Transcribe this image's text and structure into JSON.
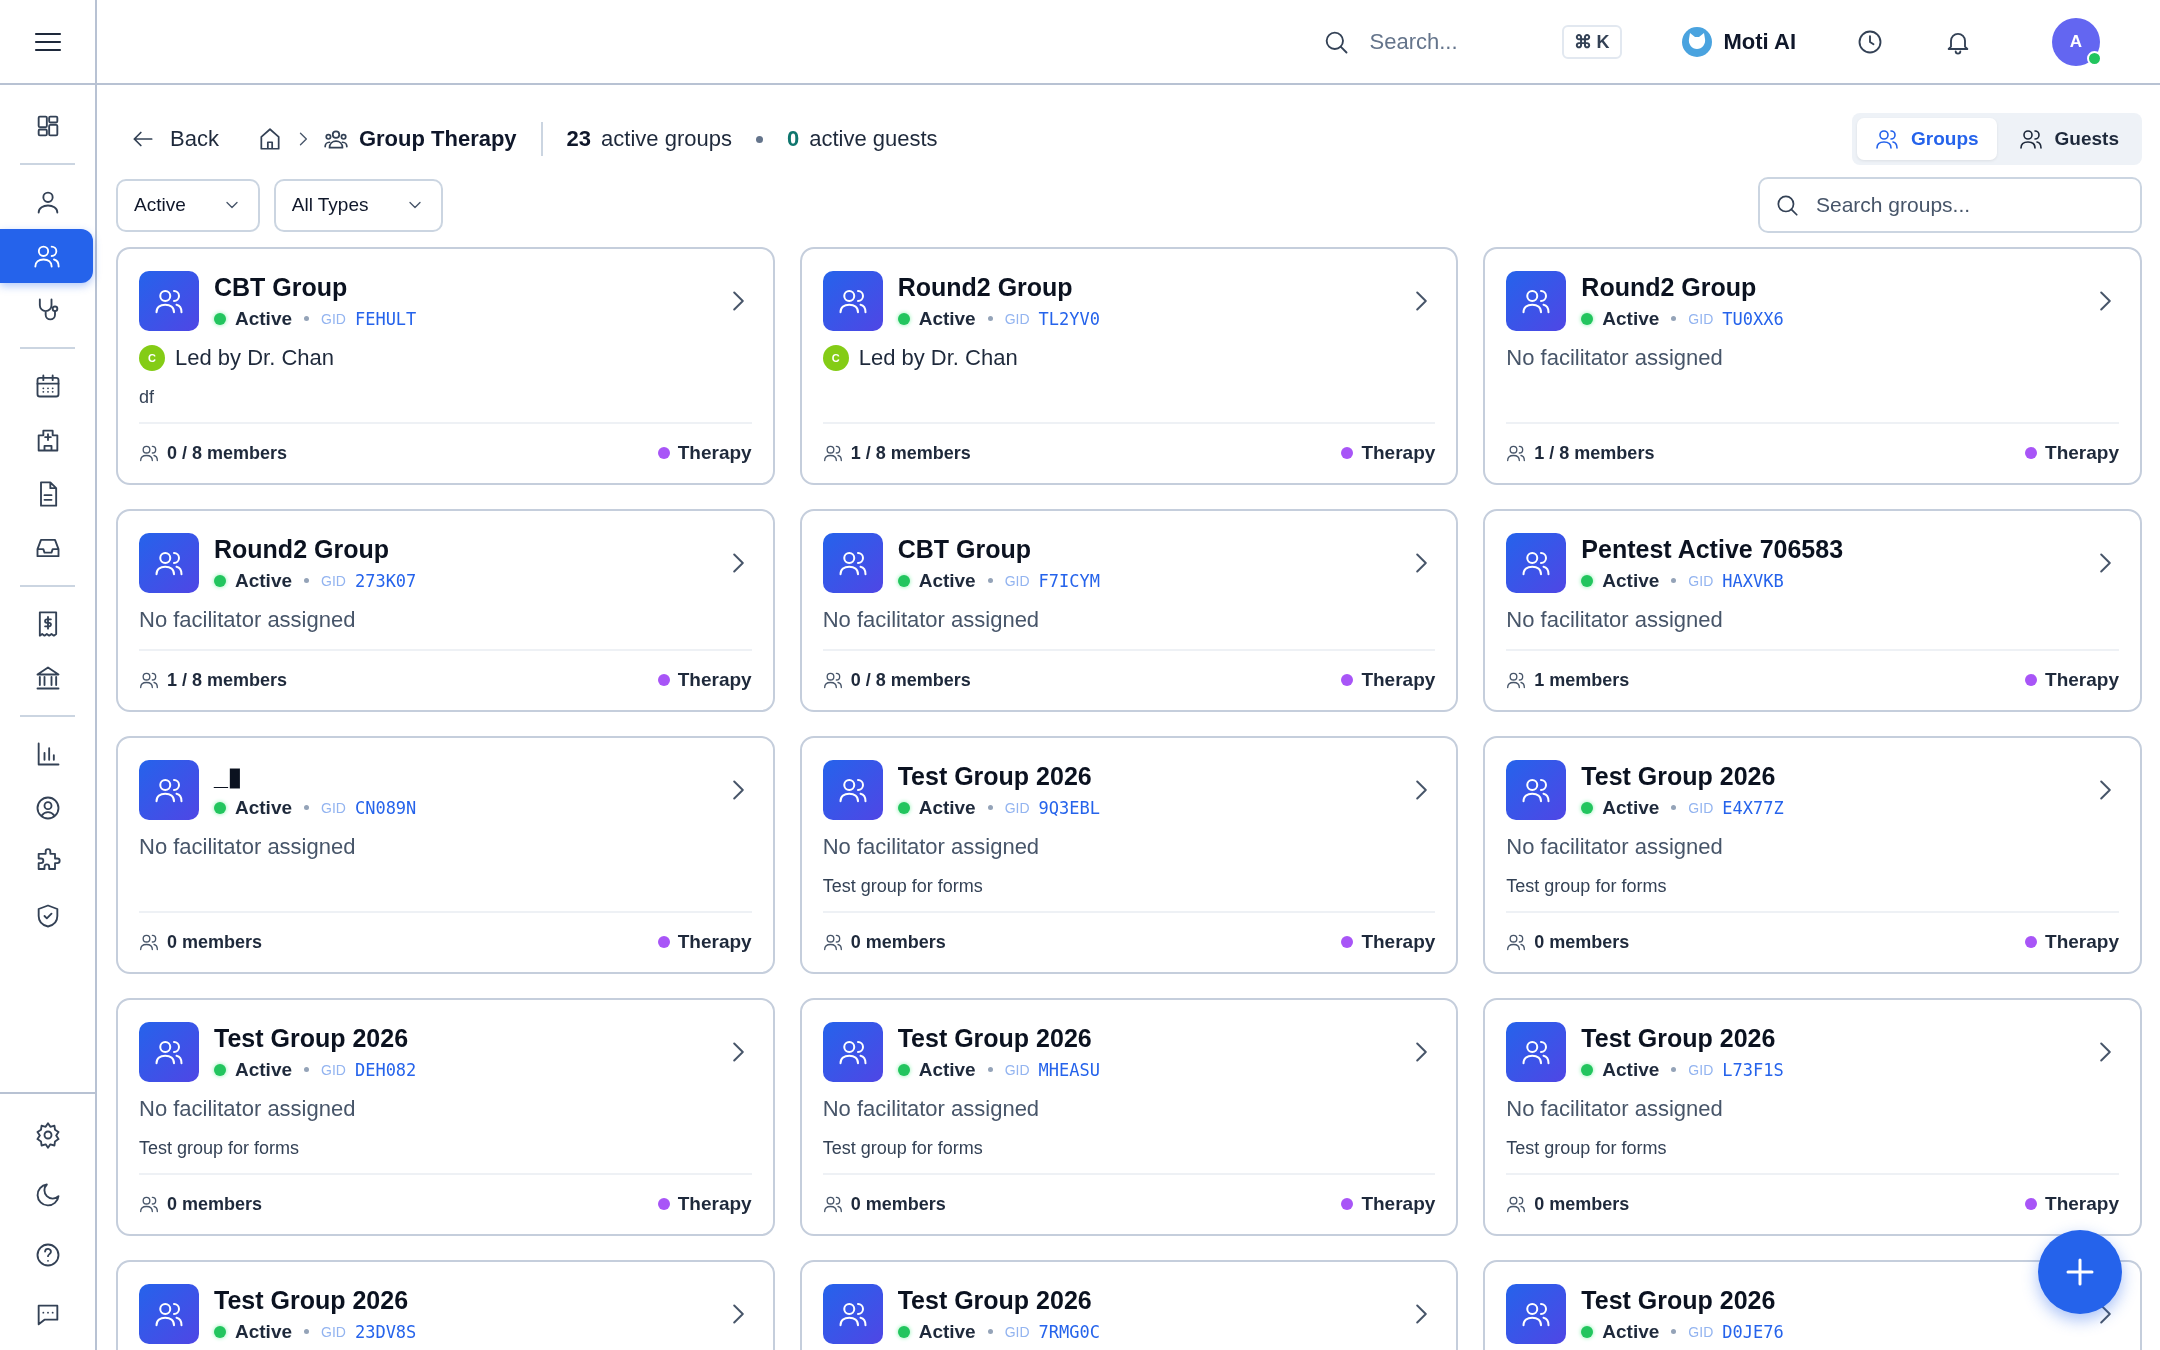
{
  "topbar": {
    "search": {
      "placeholder": "Search..."
    },
    "shortcut": "⌘ K",
    "assistant": "Moti AI",
    "avatar": {
      "initial": "A",
      "online": true
    }
  },
  "sidebar": {
    "groups": [
      [
        {
          "kind": "dashboard",
          "selected": false
        }
      ],
      [
        {
          "kind": "user",
          "selected": false
        },
        {
          "kind": "users",
          "selected": true
        },
        {
          "kind": "stethoscope",
          "selected": false
        }
      ],
      [
        {
          "kind": "calendar",
          "selected": false
        },
        {
          "kind": "hospital",
          "selected": false
        },
        {
          "kind": "file",
          "selected": false
        },
        {
          "kind": "inbox",
          "selected": false
        }
      ],
      [
        {
          "kind": "receipt",
          "selected": false
        },
        {
          "kind": "bank",
          "selected": false
        }
      ],
      [
        {
          "kind": "chart",
          "selected": false
        },
        {
          "kind": "user-circle",
          "selected": false
        },
        {
          "kind": "puzzle",
          "selected": false
        },
        {
          "kind": "shield",
          "selected": false
        }
      ]
    ],
    "bottom": [
      {
        "kind": "gear",
        "selected": false
      },
      {
        "kind": "moon",
        "selected": false
      },
      {
        "kind": "help",
        "selected": false
      },
      {
        "kind": "chat",
        "selected": false
      }
    ]
  },
  "header": {
    "back": "Back",
    "crumb": "Group Therapy",
    "stats": [
      {
        "count": "23",
        "label": "active groups",
        "kind": "plain"
      },
      {
        "count": "0",
        "label": "active guests",
        "kind": "accent"
      }
    ],
    "tabs": [
      {
        "label": "Groups",
        "selected": true
      },
      {
        "label": "Guests",
        "selected": false
      }
    ]
  },
  "filters": [
    {
      "value": "Active"
    },
    {
      "value": "All Types"
    }
  ],
  "search": {
    "placeholder": "Search groups..."
  },
  "groups": [
    {
      "name": "CBT Group",
      "status": "Active",
      "gid_label": "GID",
      "gid": "FEHULT",
      "facilitator": {
        "kind": "led",
        "text": "Led by Dr. Chan",
        "initial": "C"
      },
      "description": "df",
      "members": "0 / 8 members",
      "type": {
        "label": "Therapy",
        "color": "#a855f7"
      }
    },
    {
      "name": "Round2 Group",
      "status": "Active",
      "gid_label": "GID",
      "gid": "TL2YV0",
      "facilitator": {
        "kind": "led",
        "text": "Led by Dr. Chan",
        "initial": "C"
      },
      "members": "1 / 8 members",
      "type": {
        "label": "Therapy",
        "color": "#a855f7"
      }
    },
    {
      "name": "Round2 Group",
      "status": "Active",
      "gid_label": "GID",
      "gid": "TU0XX6",
      "facilitator": {
        "kind": "none",
        "text": "No facilitator assigned"
      },
      "members": "1 / 8 members",
      "type": {
        "label": "Therapy",
        "color": "#a855f7"
      }
    },
    {
      "name": "Round2 Group",
      "status": "Active",
      "gid_label": "GID",
      "gid": "273K07",
      "facilitator": {
        "kind": "none",
        "text": "No facilitator assigned"
      },
      "members": "1 / 8 members",
      "type": {
        "label": "Therapy",
        "color": "#a855f7"
      }
    },
    {
      "name": "CBT Group",
      "status": "Active",
      "gid_label": "GID",
      "gid": "F7ICYM",
      "facilitator": {
        "kind": "none",
        "text": "No facilitator assigned"
      },
      "members": "0 / 8 members",
      "type": {
        "label": "Therapy",
        "color": "#a855f7"
      }
    },
    {
      "name": "Pentest Active 706583",
      "status": "Active",
      "gid_label": "GID",
      "gid": "HAXVKB",
      "facilitator": {
        "kind": "none",
        "text": "No facilitator assigned"
      },
      "members": "1 members",
      "type": {
        "label": "Therapy",
        "color": "#a855f7"
      }
    },
    {
      "name": "_▮",
      "status": "Active",
      "gid_label": "GID",
      "gid": "CN089N",
      "facilitator": {
        "kind": "none",
        "text": "No facilitator assigned"
      },
      "members": "0 members",
      "type": {
        "label": "Therapy",
        "color": "#a855f7"
      }
    },
    {
      "name": "Test Group 2026",
      "status": "Active",
      "gid_label": "GID",
      "gid": "9Q3EBL",
      "facilitator": {
        "kind": "none",
        "text": "No facilitator assigned"
      },
      "description": "Test group for forms",
      "members": "0 members",
      "type": {
        "label": "Therapy",
        "color": "#a855f7"
      }
    },
    {
      "name": "Test Group 2026",
      "status": "Active",
      "gid_label": "GID",
      "gid": "E4X77Z",
      "facilitator": {
        "kind": "none",
        "text": "No facilitator assigned"
      },
      "description": "Test group for forms",
      "members": "0 members",
      "type": {
        "label": "Therapy",
        "color": "#a855f7"
      }
    },
    {
      "name": "Test Group 2026",
      "status": "Active",
      "gid_label": "GID",
      "gid": "DEH082",
      "facilitator": {
        "kind": "none",
        "text": "No facilitator assigned"
      },
      "description": "Test group for forms",
      "members": "0 members",
      "type": {
        "label": "Therapy",
        "color": "#a855f7"
      }
    },
    {
      "name": "Test Group 2026",
      "status": "Active",
      "gid_label": "GID",
      "gid": "MHEASU",
      "facilitator": {
        "kind": "none",
        "text": "No facilitator assigned"
      },
      "description": "Test group for forms",
      "members": "0 members",
      "type": {
        "label": "Therapy",
        "color": "#a855f7"
      }
    },
    {
      "name": "Test Group 2026",
      "status": "Active",
      "gid_label": "GID",
      "gid": "L73F1S",
      "facilitator": {
        "kind": "none",
        "text": "No facilitator assigned"
      },
      "description": "Test group for forms",
      "members": "0 members",
      "type": {
        "label": "Therapy",
        "color": "#a855f7"
      }
    },
    {
      "name": "Test Group 2026",
      "status": "Active",
      "gid_label": "GID",
      "gid": "23DV8S"
    },
    {
      "name": "Test Group 2026",
      "status": "Active",
      "gid_label": "GID",
      "gid": "7RMG0C"
    },
    {
      "name": "Test Group 2026",
      "status": "Active",
      "gid_label": "GID",
      "gid": "D0JE76"
    }
  ]
}
